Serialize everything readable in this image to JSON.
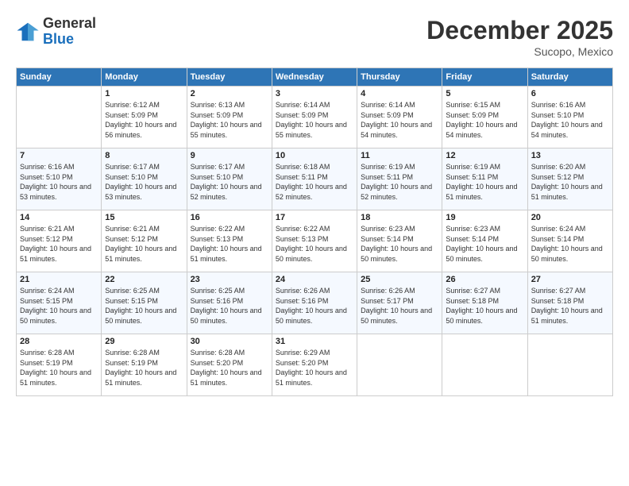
{
  "logo": {
    "general": "General",
    "blue": "Blue"
  },
  "title": "December 2025",
  "location": "Sucopo, Mexico",
  "days_of_week": [
    "Sunday",
    "Monday",
    "Tuesday",
    "Wednesday",
    "Thursday",
    "Friday",
    "Saturday"
  ],
  "weeks": [
    [
      {
        "day": "",
        "sunrise": "",
        "sunset": "",
        "daylight": ""
      },
      {
        "day": "1",
        "sunrise": "Sunrise: 6:12 AM",
        "sunset": "Sunset: 5:09 PM",
        "daylight": "Daylight: 10 hours and 56 minutes."
      },
      {
        "day": "2",
        "sunrise": "Sunrise: 6:13 AM",
        "sunset": "Sunset: 5:09 PM",
        "daylight": "Daylight: 10 hours and 55 minutes."
      },
      {
        "day": "3",
        "sunrise": "Sunrise: 6:14 AM",
        "sunset": "Sunset: 5:09 PM",
        "daylight": "Daylight: 10 hours and 55 minutes."
      },
      {
        "day": "4",
        "sunrise": "Sunrise: 6:14 AM",
        "sunset": "Sunset: 5:09 PM",
        "daylight": "Daylight: 10 hours and 54 minutes."
      },
      {
        "day": "5",
        "sunrise": "Sunrise: 6:15 AM",
        "sunset": "Sunset: 5:09 PM",
        "daylight": "Daylight: 10 hours and 54 minutes."
      },
      {
        "day": "6",
        "sunrise": "Sunrise: 6:16 AM",
        "sunset": "Sunset: 5:10 PM",
        "daylight": "Daylight: 10 hours and 54 minutes."
      }
    ],
    [
      {
        "day": "7",
        "sunrise": "Sunrise: 6:16 AM",
        "sunset": "Sunset: 5:10 PM",
        "daylight": "Daylight: 10 hours and 53 minutes."
      },
      {
        "day": "8",
        "sunrise": "Sunrise: 6:17 AM",
        "sunset": "Sunset: 5:10 PM",
        "daylight": "Daylight: 10 hours and 53 minutes."
      },
      {
        "day": "9",
        "sunrise": "Sunrise: 6:17 AM",
        "sunset": "Sunset: 5:10 PM",
        "daylight": "Daylight: 10 hours and 52 minutes."
      },
      {
        "day": "10",
        "sunrise": "Sunrise: 6:18 AM",
        "sunset": "Sunset: 5:11 PM",
        "daylight": "Daylight: 10 hours and 52 minutes."
      },
      {
        "day": "11",
        "sunrise": "Sunrise: 6:19 AM",
        "sunset": "Sunset: 5:11 PM",
        "daylight": "Daylight: 10 hours and 52 minutes."
      },
      {
        "day": "12",
        "sunrise": "Sunrise: 6:19 AM",
        "sunset": "Sunset: 5:11 PM",
        "daylight": "Daylight: 10 hours and 51 minutes."
      },
      {
        "day": "13",
        "sunrise": "Sunrise: 6:20 AM",
        "sunset": "Sunset: 5:12 PM",
        "daylight": "Daylight: 10 hours and 51 minutes."
      }
    ],
    [
      {
        "day": "14",
        "sunrise": "Sunrise: 6:21 AM",
        "sunset": "Sunset: 5:12 PM",
        "daylight": "Daylight: 10 hours and 51 minutes."
      },
      {
        "day": "15",
        "sunrise": "Sunrise: 6:21 AM",
        "sunset": "Sunset: 5:12 PM",
        "daylight": "Daylight: 10 hours and 51 minutes."
      },
      {
        "day": "16",
        "sunrise": "Sunrise: 6:22 AM",
        "sunset": "Sunset: 5:13 PM",
        "daylight": "Daylight: 10 hours and 51 minutes."
      },
      {
        "day": "17",
        "sunrise": "Sunrise: 6:22 AM",
        "sunset": "Sunset: 5:13 PM",
        "daylight": "Daylight: 10 hours and 50 minutes."
      },
      {
        "day": "18",
        "sunrise": "Sunrise: 6:23 AM",
        "sunset": "Sunset: 5:14 PM",
        "daylight": "Daylight: 10 hours and 50 minutes."
      },
      {
        "day": "19",
        "sunrise": "Sunrise: 6:23 AM",
        "sunset": "Sunset: 5:14 PM",
        "daylight": "Daylight: 10 hours and 50 minutes."
      },
      {
        "day": "20",
        "sunrise": "Sunrise: 6:24 AM",
        "sunset": "Sunset: 5:14 PM",
        "daylight": "Daylight: 10 hours and 50 minutes."
      }
    ],
    [
      {
        "day": "21",
        "sunrise": "Sunrise: 6:24 AM",
        "sunset": "Sunset: 5:15 PM",
        "daylight": "Daylight: 10 hours and 50 minutes."
      },
      {
        "day": "22",
        "sunrise": "Sunrise: 6:25 AM",
        "sunset": "Sunset: 5:15 PM",
        "daylight": "Daylight: 10 hours and 50 minutes."
      },
      {
        "day": "23",
        "sunrise": "Sunrise: 6:25 AM",
        "sunset": "Sunset: 5:16 PM",
        "daylight": "Daylight: 10 hours and 50 minutes."
      },
      {
        "day": "24",
        "sunrise": "Sunrise: 6:26 AM",
        "sunset": "Sunset: 5:16 PM",
        "daylight": "Daylight: 10 hours and 50 minutes."
      },
      {
        "day": "25",
        "sunrise": "Sunrise: 6:26 AM",
        "sunset": "Sunset: 5:17 PM",
        "daylight": "Daylight: 10 hours and 50 minutes."
      },
      {
        "day": "26",
        "sunrise": "Sunrise: 6:27 AM",
        "sunset": "Sunset: 5:18 PM",
        "daylight": "Daylight: 10 hours and 50 minutes."
      },
      {
        "day": "27",
        "sunrise": "Sunrise: 6:27 AM",
        "sunset": "Sunset: 5:18 PM",
        "daylight": "Daylight: 10 hours and 51 minutes."
      }
    ],
    [
      {
        "day": "28",
        "sunrise": "Sunrise: 6:28 AM",
        "sunset": "Sunset: 5:19 PM",
        "daylight": "Daylight: 10 hours and 51 minutes."
      },
      {
        "day": "29",
        "sunrise": "Sunrise: 6:28 AM",
        "sunset": "Sunset: 5:19 PM",
        "daylight": "Daylight: 10 hours and 51 minutes."
      },
      {
        "day": "30",
        "sunrise": "Sunrise: 6:28 AM",
        "sunset": "Sunset: 5:20 PM",
        "daylight": "Daylight: 10 hours and 51 minutes."
      },
      {
        "day": "31",
        "sunrise": "Sunrise: 6:29 AM",
        "sunset": "Sunset: 5:20 PM",
        "daylight": "Daylight: 10 hours and 51 minutes."
      },
      {
        "day": "",
        "sunrise": "",
        "sunset": "",
        "daylight": ""
      },
      {
        "day": "",
        "sunrise": "",
        "sunset": "",
        "daylight": ""
      },
      {
        "day": "",
        "sunrise": "",
        "sunset": "",
        "daylight": ""
      }
    ]
  ]
}
